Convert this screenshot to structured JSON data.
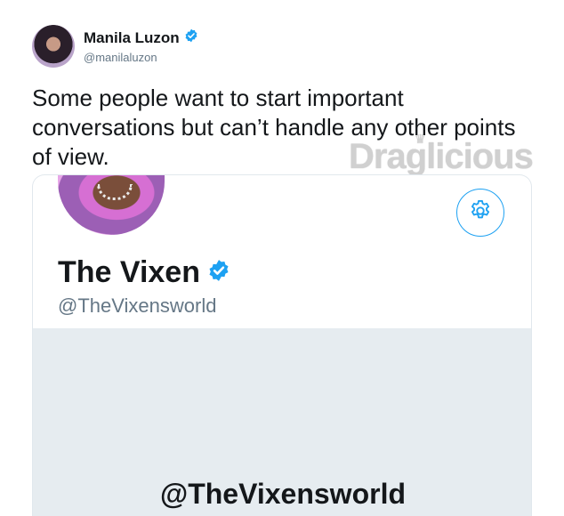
{
  "tweet": {
    "author_name": "Manila Luzon",
    "author_handle": "@manilaluzon",
    "text": "Some people want to start important conversations but can’t handle any other points of view."
  },
  "watermark": "Draglicious",
  "embedded_profile": {
    "name": "The Vixen",
    "handle": "@TheVixensworld",
    "banner_text": "@TheVixensworld"
  },
  "colors": {
    "verified_blue": "#1da1f2",
    "handle_gray": "#657786",
    "banner_bg": "#e6ecf0"
  },
  "icons": [
    "verified-badge-icon",
    "settings-gear-icon"
  ]
}
